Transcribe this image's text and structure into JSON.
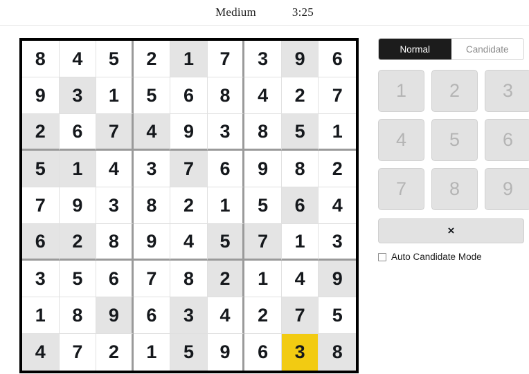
{
  "header": {
    "difficulty": "Medium",
    "timer": "3:25"
  },
  "board": {
    "rows": [
      [
        {
          "value": "8",
          "state": "normal"
        },
        {
          "value": "4",
          "state": "normal"
        },
        {
          "value": "5",
          "state": "normal"
        },
        {
          "value": "2",
          "state": "normal"
        },
        {
          "value": "1",
          "state": "shaded"
        },
        {
          "value": "7",
          "state": "normal"
        },
        {
          "value": "3",
          "state": "normal"
        },
        {
          "value": "9",
          "state": "shaded"
        },
        {
          "value": "6",
          "state": "normal"
        }
      ],
      [
        {
          "value": "9",
          "state": "normal"
        },
        {
          "value": "3",
          "state": "shaded"
        },
        {
          "value": "1",
          "state": "normal"
        },
        {
          "value": "5",
          "state": "normal"
        },
        {
          "value": "6",
          "state": "normal"
        },
        {
          "value": "8",
          "state": "normal"
        },
        {
          "value": "4",
          "state": "normal"
        },
        {
          "value": "2",
          "state": "normal"
        },
        {
          "value": "7",
          "state": "normal"
        }
      ],
      [
        {
          "value": "2",
          "state": "shaded"
        },
        {
          "value": "6",
          "state": "normal"
        },
        {
          "value": "7",
          "state": "shaded"
        },
        {
          "value": "4",
          "state": "shaded"
        },
        {
          "value": "9",
          "state": "normal"
        },
        {
          "value": "3",
          "state": "normal"
        },
        {
          "value": "8",
          "state": "normal"
        },
        {
          "value": "5",
          "state": "shaded"
        },
        {
          "value": "1",
          "state": "normal"
        }
      ],
      [
        {
          "value": "5",
          "state": "shaded"
        },
        {
          "value": "1",
          "state": "shaded"
        },
        {
          "value": "4",
          "state": "normal"
        },
        {
          "value": "3",
          "state": "normal"
        },
        {
          "value": "7",
          "state": "shaded"
        },
        {
          "value": "6",
          "state": "normal"
        },
        {
          "value": "9",
          "state": "normal"
        },
        {
          "value": "8",
          "state": "normal"
        },
        {
          "value": "2",
          "state": "normal"
        }
      ],
      [
        {
          "value": "7",
          "state": "normal"
        },
        {
          "value": "9",
          "state": "normal"
        },
        {
          "value": "3",
          "state": "normal"
        },
        {
          "value": "8",
          "state": "normal"
        },
        {
          "value": "2",
          "state": "normal"
        },
        {
          "value": "1",
          "state": "normal"
        },
        {
          "value": "5",
          "state": "normal"
        },
        {
          "value": "6",
          "state": "shaded"
        },
        {
          "value": "4",
          "state": "normal"
        }
      ],
      [
        {
          "value": "6",
          "state": "shaded"
        },
        {
          "value": "2",
          "state": "shaded"
        },
        {
          "value": "8",
          "state": "normal"
        },
        {
          "value": "9",
          "state": "normal"
        },
        {
          "value": "4",
          "state": "normal"
        },
        {
          "value": "5",
          "state": "shaded"
        },
        {
          "value": "7",
          "state": "shaded"
        },
        {
          "value": "1",
          "state": "normal"
        },
        {
          "value": "3",
          "state": "normal"
        }
      ],
      [
        {
          "value": "3",
          "state": "normal"
        },
        {
          "value": "5",
          "state": "normal"
        },
        {
          "value": "6",
          "state": "normal"
        },
        {
          "value": "7",
          "state": "normal"
        },
        {
          "value": "8",
          "state": "normal"
        },
        {
          "value": "2",
          "state": "shaded"
        },
        {
          "value": "1",
          "state": "normal"
        },
        {
          "value": "4",
          "state": "normal"
        },
        {
          "value": "9",
          "state": "shaded"
        }
      ],
      [
        {
          "value": "1",
          "state": "normal"
        },
        {
          "value": "8",
          "state": "normal"
        },
        {
          "value": "9",
          "state": "shaded"
        },
        {
          "value": "6",
          "state": "normal"
        },
        {
          "value": "3",
          "state": "shaded"
        },
        {
          "value": "4",
          "state": "normal"
        },
        {
          "value": "2",
          "state": "normal"
        },
        {
          "value": "7",
          "state": "shaded"
        },
        {
          "value": "5",
          "state": "normal"
        }
      ],
      [
        {
          "value": "4",
          "state": "shaded"
        },
        {
          "value": "7",
          "state": "normal"
        },
        {
          "value": "2",
          "state": "normal"
        },
        {
          "value": "1",
          "state": "normal"
        },
        {
          "value": "5",
          "state": "shaded"
        },
        {
          "value": "9",
          "state": "normal"
        },
        {
          "value": "6",
          "state": "normal"
        },
        {
          "value": "3",
          "state": "selected"
        },
        {
          "value": "8",
          "state": "shaded"
        }
      ]
    ]
  },
  "panel": {
    "modes": [
      {
        "label": "Normal",
        "active": true
      },
      {
        "label": "Candidate",
        "active": false
      }
    ],
    "numbers": [
      "1",
      "2",
      "3",
      "4",
      "5",
      "6",
      "7",
      "8",
      "9"
    ],
    "erase_label": "×",
    "auto_candidate": {
      "label": "Auto Candidate Mode",
      "checked": false
    }
  },
  "colors": {
    "selected_cell": "#f2cb12",
    "shaded_cell": "#e4e4e4",
    "board_border": "#000000",
    "box_border": "#9a9a9a",
    "active_mode_bg": "#1c1c1c"
  }
}
